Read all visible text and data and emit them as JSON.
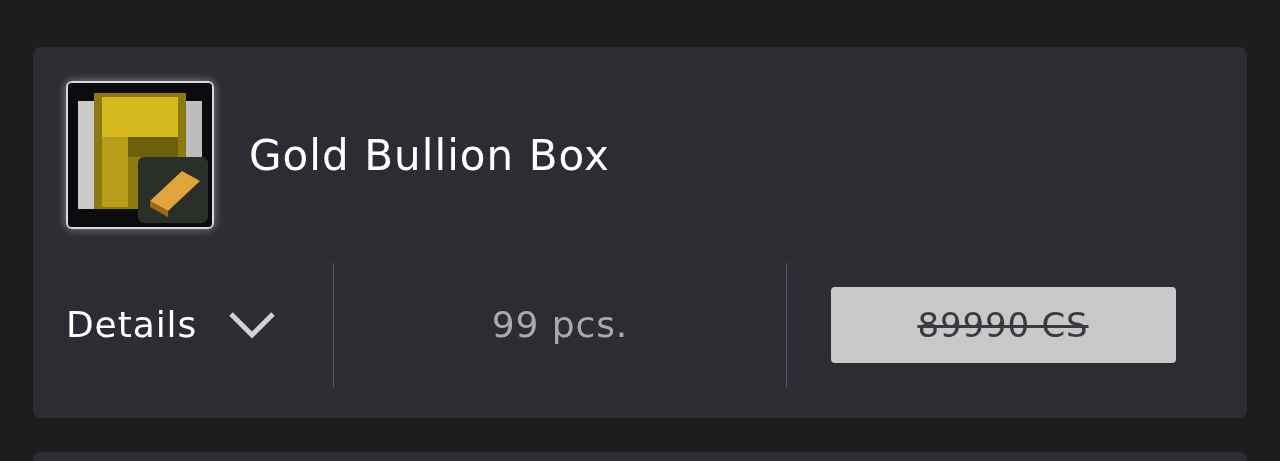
{
  "item": {
    "name": "Gold Bullion Box",
    "thumbnail": {
      "kind": "picture",
      "selected": true
    }
  },
  "details": {
    "label": "Details",
    "expanded": false
  },
  "quantity": "99 pcs.",
  "price": {
    "label": "89990 CS",
    "strikethrough": true
  }
}
